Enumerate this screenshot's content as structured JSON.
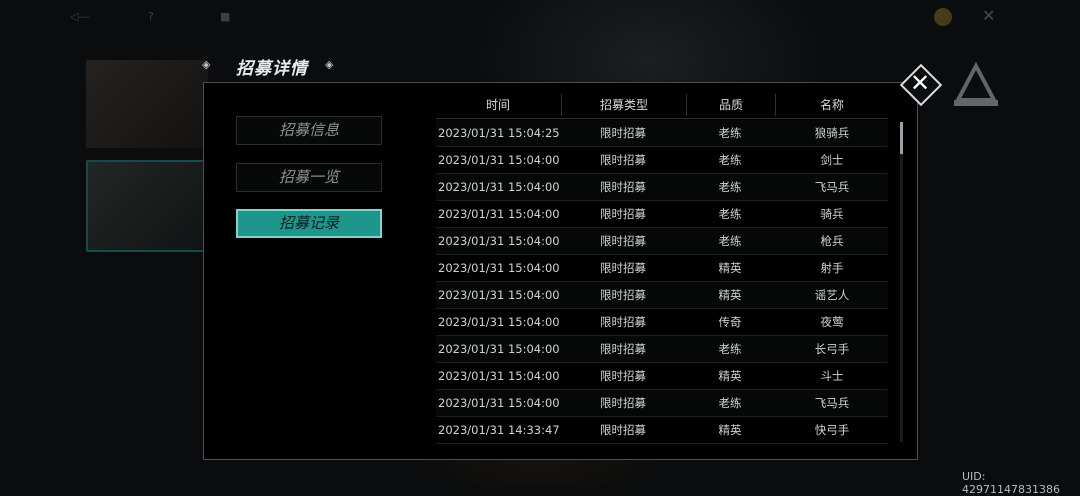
{
  "window": {
    "title": "招募详情"
  },
  "nav": [
    {
      "label": "招募信息",
      "active": false
    },
    {
      "label": "招募一览",
      "active": false
    },
    {
      "label": "招募记录",
      "active": true
    }
  ],
  "table": {
    "columns": [
      "时间",
      "招募类型",
      "品质",
      "名称"
    ],
    "rows": [
      [
        "2023/01/31 15:04:25",
        "限时招募",
        "老练",
        "狼骑兵"
      ],
      [
        "2023/01/31 15:04:00",
        "限时招募",
        "老练",
        "剑士"
      ],
      [
        "2023/01/31 15:04:00",
        "限时招募",
        "老练",
        "飞马兵"
      ],
      [
        "2023/01/31 15:04:00",
        "限时招募",
        "老练",
        "骑兵"
      ],
      [
        "2023/01/31 15:04:00",
        "限时招募",
        "老练",
        "枪兵"
      ],
      [
        "2023/01/31 15:04:00",
        "限时招募",
        "精英",
        "射手"
      ],
      [
        "2023/01/31 15:04:00",
        "限时招募",
        "精英",
        "谣艺人"
      ],
      [
        "2023/01/31 15:04:00",
        "限时招募",
        "传奇",
        "夜莺"
      ],
      [
        "2023/01/31 15:04:00",
        "限时招募",
        "老练",
        "长弓手"
      ],
      [
        "2023/01/31 15:04:00",
        "限时招募",
        "精英",
        "斗士"
      ],
      [
        "2023/01/31 15:04:00",
        "限时招募",
        "老练",
        "飞马兵"
      ],
      [
        "2023/01/31 14:33:47",
        "限时招募",
        "精英",
        "快弓手"
      ]
    ]
  },
  "footer": {
    "uid": "UID: 42971147831386"
  },
  "icons": {
    "close": "close-icon",
    "prev": "arrow-left-icon",
    "next": "arrow-right-icon"
  },
  "colors": {
    "accent": "#1f968b",
    "accent_border": "#7fd4cb",
    "panel_bg": "#000000"
  }
}
